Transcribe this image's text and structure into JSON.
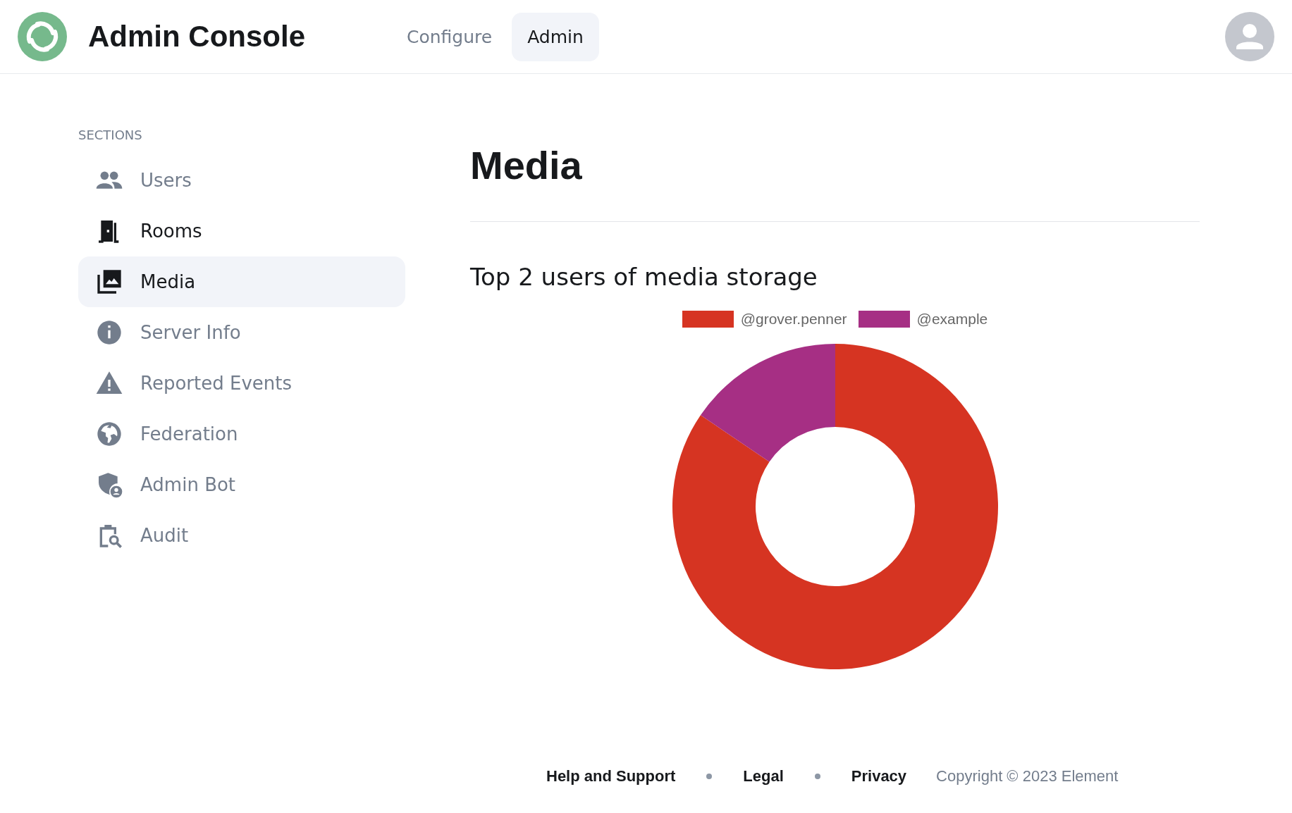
{
  "header": {
    "title": "Admin Console",
    "tabs": [
      {
        "label": "Configure",
        "selected": false
      },
      {
        "label": "Admin",
        "selected": true
      }
    ]
  },
  "sidebar": {
    "heading": "SECTIONS",
    "items": [
      {
        "label": "Users",
        "selected": false,
        "hovered": false
      },
      {
        "label": "Rooms",
        "selected": false,
        "hovered": true
      },
      {
        "label": "Media",
        "selected": true,
        "hovered": false
      },
      {
        "label": "Server Info",
        "selected": false,
        "hovered": false
      },
      {
        "label": "Reported Events",
        "selected": false,
        "hovered": false
      },
      {
        "label": "Federation",
        "selected": false,
        "hovered": false
      },
      {
        "label": "Admin Bot",
        "selected": false,
        "hovered": false
      },
      {
        "label": "Audit",
        "selected": false,
        "hovered": false
      }
    ]
  },
  "main": {
    "title": "Media",
    "subtitle": "Top 2 users of media storage",
    "legend": [
      {
        "label": "@grover.penner",
        "color": "#d63422"
      },
      {
        "label": "@example",
        "color": "#a62f84"
      }
    ]
  },
  "footer": {
    "links": [
      "Help and Support",
      "Legal",
      "Privacy"
    ],
    "copyright": "Copyright © 2023 Element"
  }
}
